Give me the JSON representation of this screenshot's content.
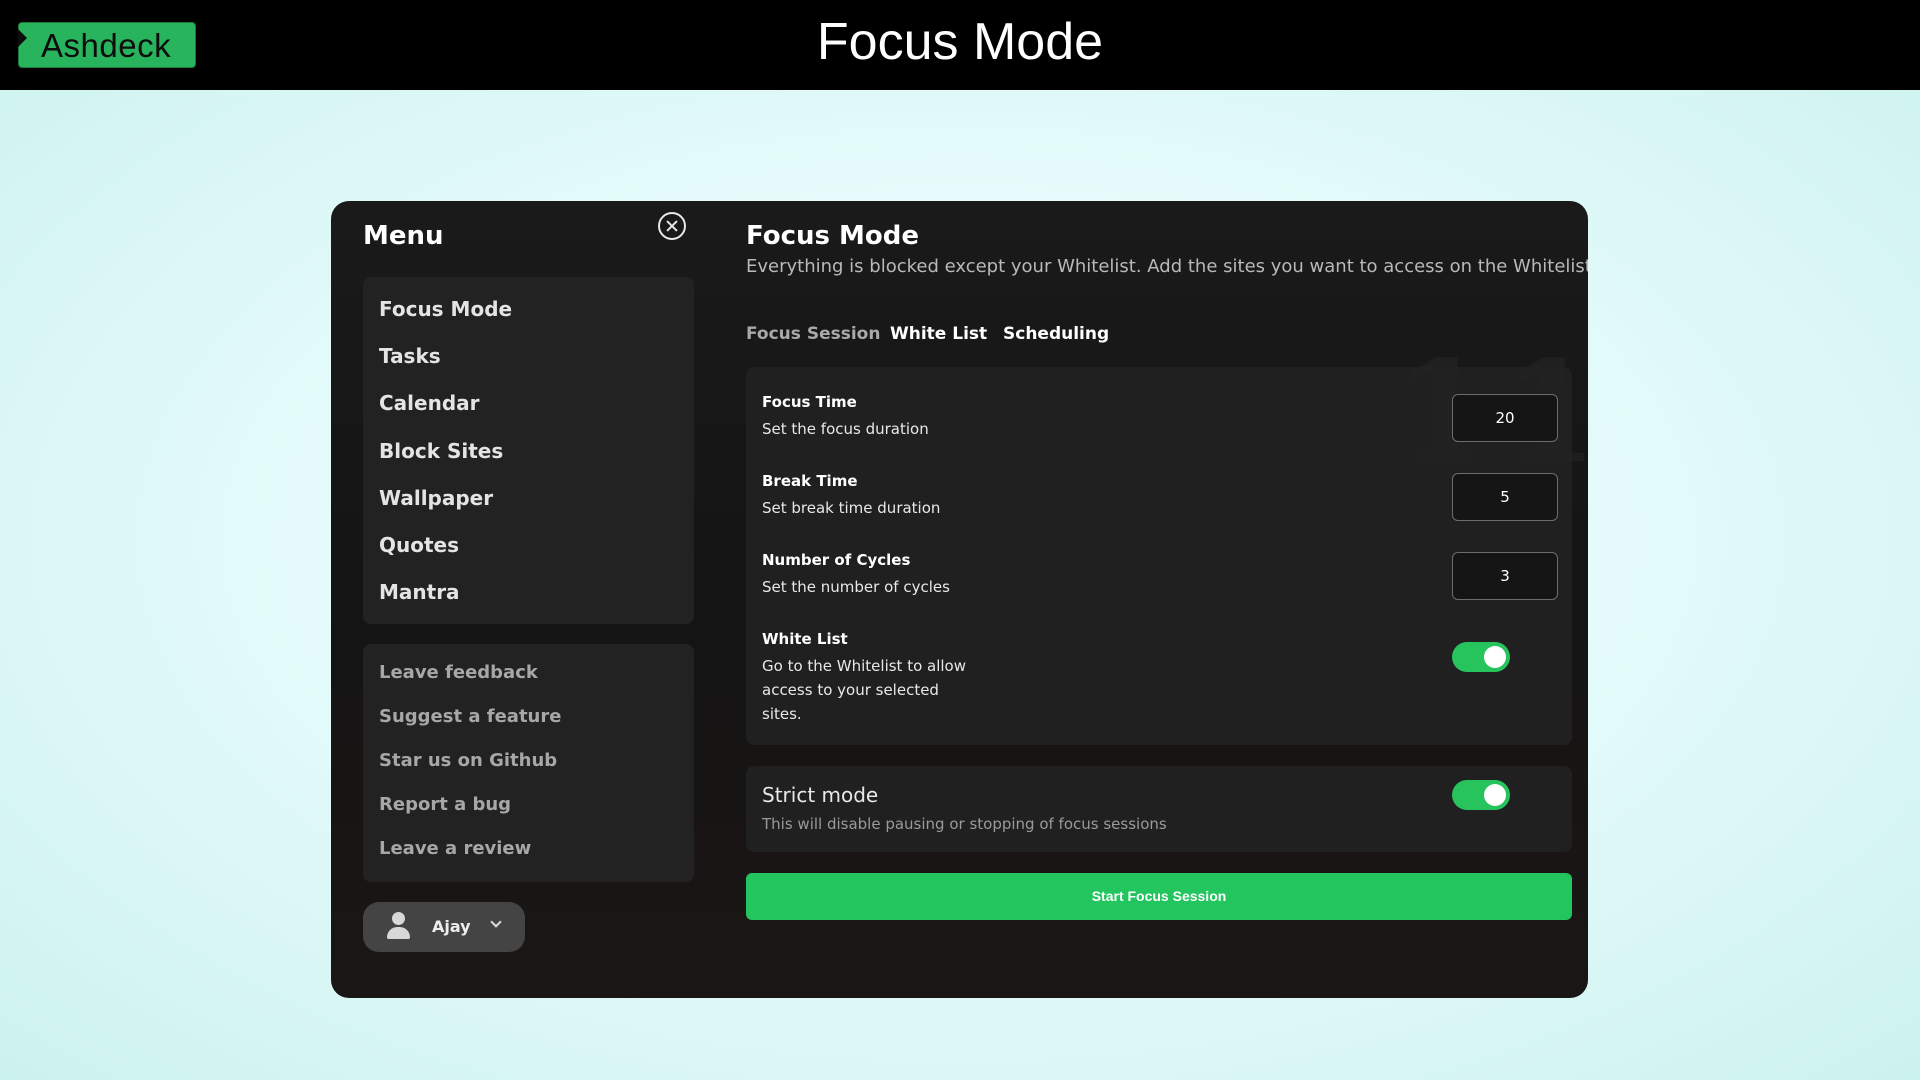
{
  "header": {
    "logo_text": "Ashdeck",
    "title": "Focus Mode"
  },
  "sidebar": {
    "title": "Menu",
    "nav": [
      "Focus Mode",
      "Tasks",
      "Calendar",
      "Block Sites",
      "Wallpaper",
      "Quotes",
      "Mantra"
    ],
    "links": [
      "Leave feedback",
      "Suggest a feature",
      "Star us on Github",
      "Report a bug",
      "Leave a review"
    ],
    "user": {
      "name": "Ajay"
    }
  },
  "main": {
    "title": "Focus Mode",
    "subtitle": "Everything is blocked except your Whitelist. Add the sites you want to access on the Whitelist",
    "tabs": [
      {
        "label": "Focus Session",
        "active": true
      },
      {
        "label": "White List",
        "active": false
      },
      {
        "label": "Scheduling",
        "active": false
      }
    ],
    "settings": {
      "focus_time": {
        "title": "Focus Time",
        "desc": "Set the focus duration",
        "value": "20"
      },
      "break_time": {
        "title": "Break Time",
        "desc": "Set break time duration",
        "value": "5"
      },
      "cycles": {
        "title": "Number of Cycles",
        "desc": "Set the number of cycles",
        "value": "3"
      },
      "white_list": {
        "title": "White List",
        "desc_lines": [
          "Go to the Whitelist to allow",
          "access to your selected",
          "sites."
        ],
        "enabled": true
      }
    },
    "strict": {
      "title": "Strict mode",
      "desc": "This will disable pausing or stopping of focus sessions",
      "enabled": true
    },
    "start_label": "Start Focus Session"
  },
  "colors": {
    "accent": "#22c55e",
    "logo_bg": "#27b45d",
    "app_bg": "#161616"
  }
}
